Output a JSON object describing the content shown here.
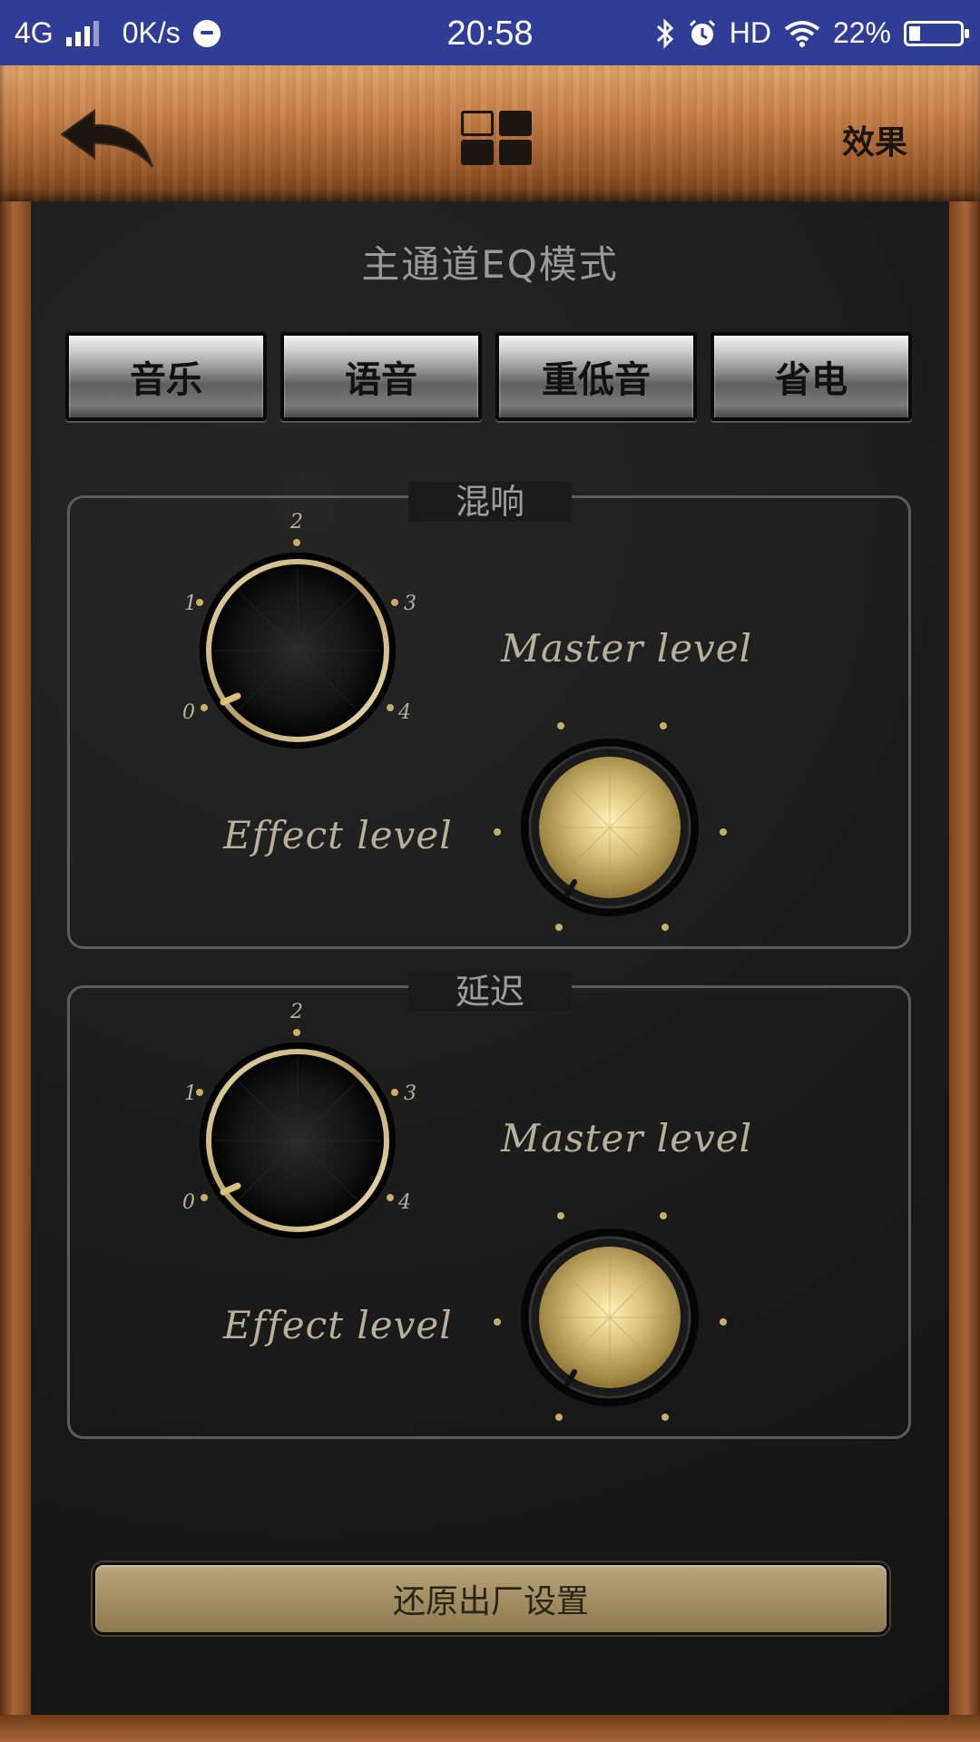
{
  "status_bar": {
    "network": "4G",
    "speed": "0K/s",
    "time": "20:58",
    "hd": "HD",
    "battery": "22%",
    "battery_level": 0.22
  },
  "header": {
    "back_icon": "back-arrow-icon",
    "grid_icon": "grid-icon",
    "effect_label": "效果"
  },
  "main": {
    "title": "主通道EQ模式",
    "modes": [
      "音乐",
      "语音",
      "重低音",
      "省电"
    ]
  },
  "sections": [
    {
      "label": "混响",
      "effect_knob": {
        "ticks": [
          "0",
          "1",
          "2",
          "3",
          "4"
        ],
        "value": 0
      },
      "master_label": "Master level",
      "effect_label": "Effect level",
      "master_knob": {
        "value": 0
      }
    },
    {
      "label": "延迟",
      "effect_knob": {
        "ticks": [
          "0",
          "1",
          "2",
          "3",
          "4"
        ],
        "value": 0
      },
      "master_label": "Master level",
      "effect_label": "Effect level",
      "master_knob": {
        "value": 0
      }
    }
  ],
  "footer": {
    "reset_label": "还原出厂设置"
  },
  "colors": {
    "status_bar": "#2f3d96",
    "wood": "#a8663a",
    "gold": "#d8c27a",
    "panel": "#1a1a1a"
  }
}
